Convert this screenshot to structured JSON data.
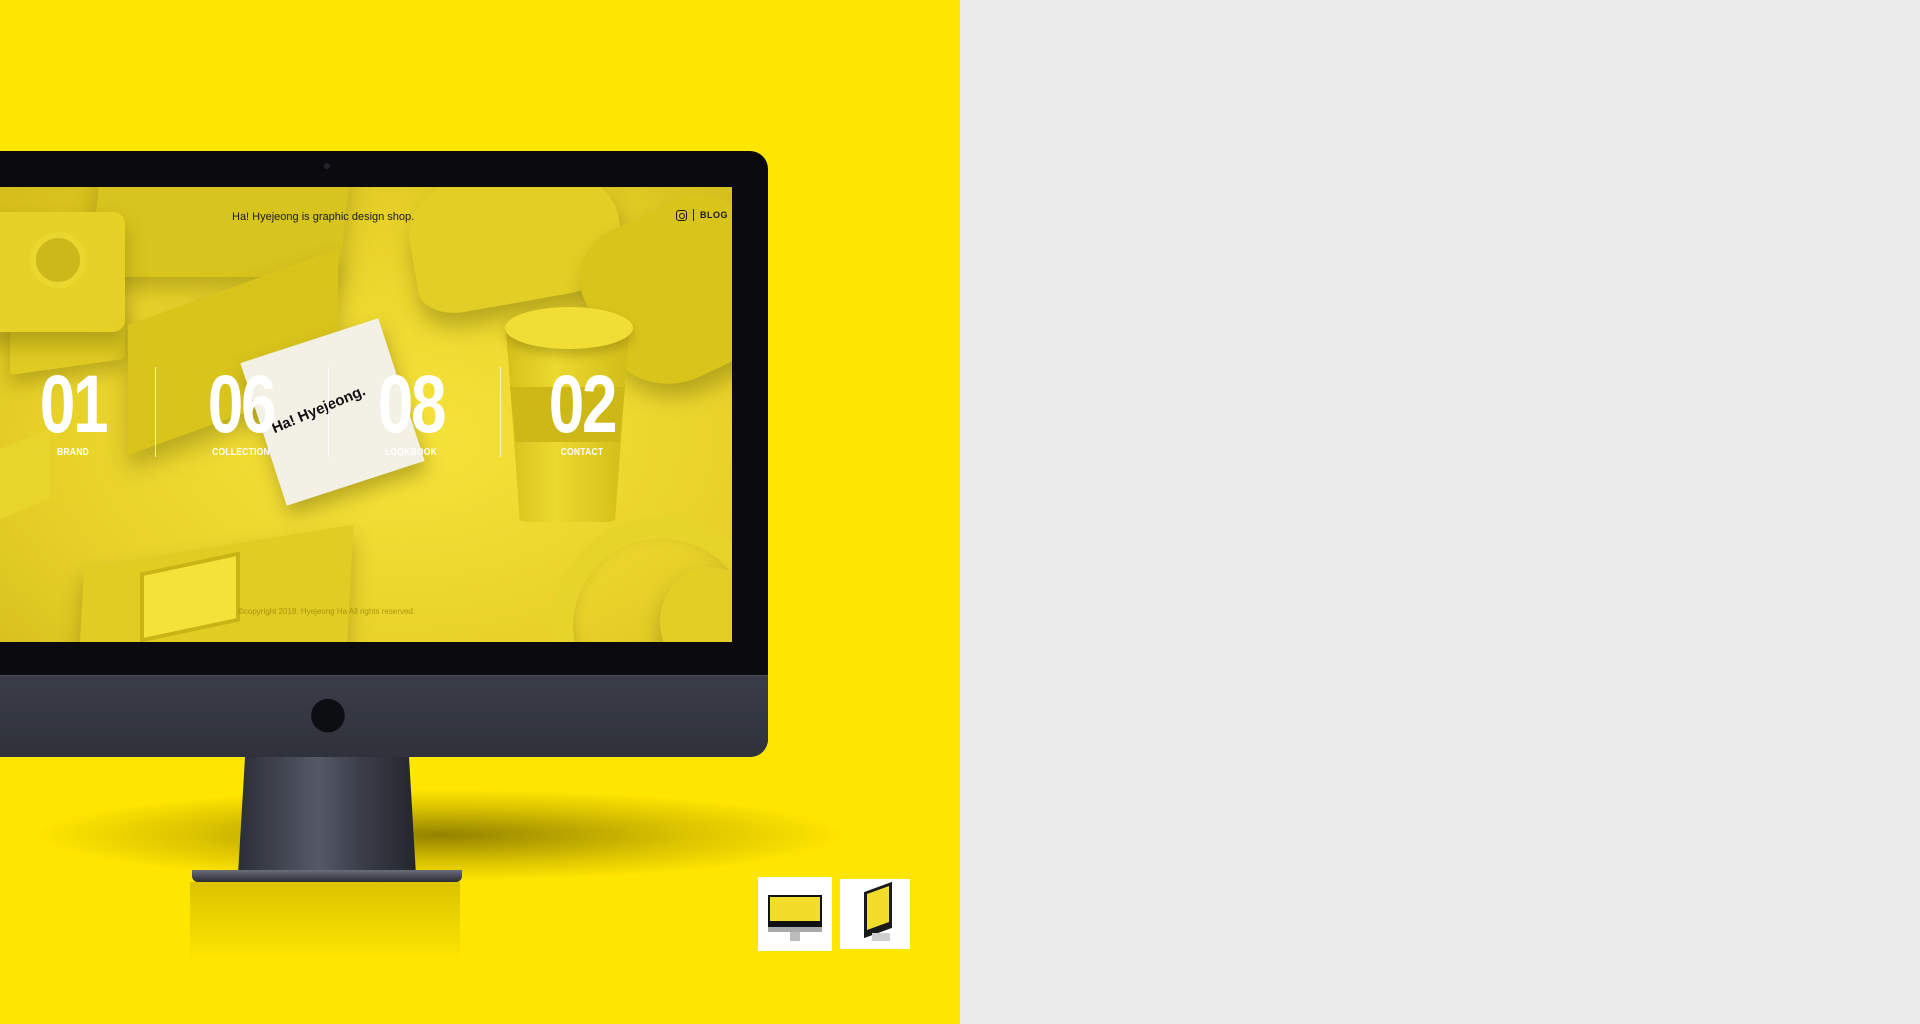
{
  "site": {
    "tagline": "Ha! Hyejeong is graphic design shop.",
    "menu": {
      "instagram_icon": "instagram-icon",
      "blog_label": "BLOG"
    },
    "card_text": "Ha! Hyejeong.",
    "nav": [
      {
        "number": "01",
        "label": "BRAND"
      },
      {
        "number": "06",
        "label": "COLLECTION"
      },
      {
        "number": "08",
        "label": "LOOKBOOK"
      },
      {
        "number": "02",
        "label": "CONTACT"
      }
    ],
    "copyright": "©copyright 2018. Hyejeong Ha All rights reserved."
  },
  "device": {
    "logo_icon": "apple-logo-icon"
  },
  "gallery": {
    "thumbnails": [
      {
        "name": "imac-front-view",
        "active": true
      },
      {
        "name": "imac-side-view",
        "active": false
      }
    ]
  },
  "colors": {
    "panel_bg": "#ffe600",
    "page_bg": "#ebebeb",
    "bezel": "#0b0b0f",
    "chin": "#34373f"
  }
}
